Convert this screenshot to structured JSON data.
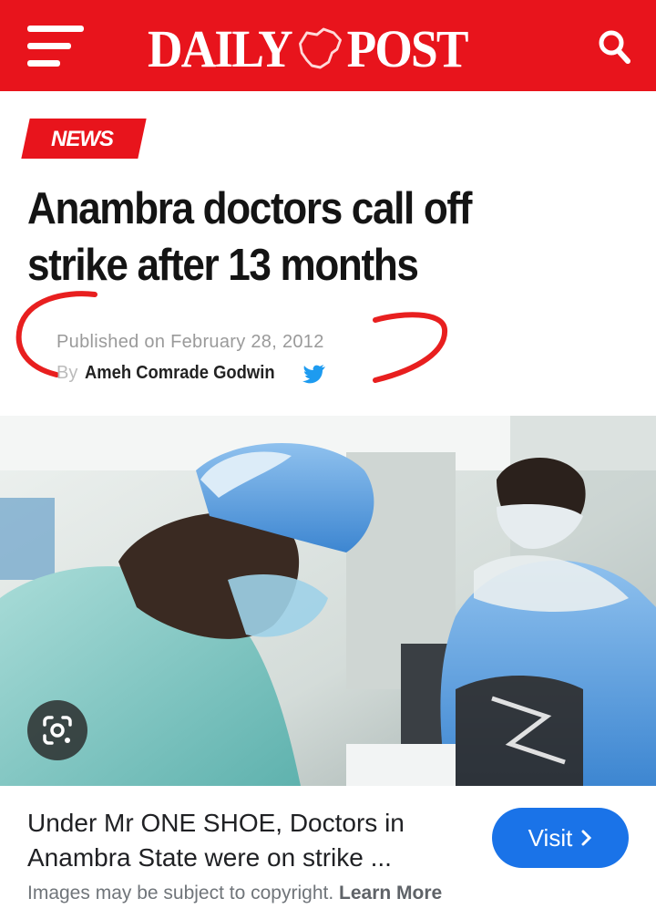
{
  "header": {
    "logo_left": "DAILY",
    "logo_right": "POST",
    "background_color": "#e8141c"
  },
  "article": {
    "category": "NEWS",
    "headline": "Anambra doctors call off strike after 13 months",
    "published": "Published on February 28, 2012",
    "by_prefix": "By",
    "author": "Ameh Comrade Godwin"
  },
  "result": {
    "caption": "Under Mr ONE SHOE, Doctors in Anambra State were on strike ...",
    "visit_label": "Visit",
    "visit_color": "#1a73e8",
    "notice": "Images may be subject to copyright.",
    "learn_more": "Learn More"
  },
  "icons": [
    "menu-icon",
    "nigeria-map-icon",
    "search-icon",
    "twitter-icon",
    "lens-icon",
    "chevron-right-icon"
  ]
}
